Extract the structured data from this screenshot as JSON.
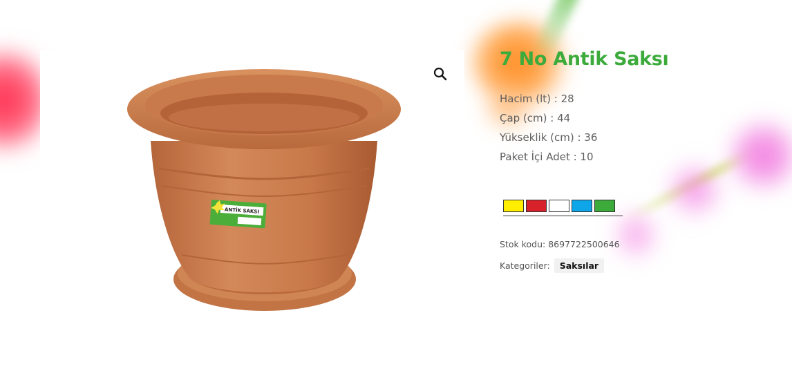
{
  "product": {
    "title": "7 No Antik Saksı",
    "specs": [
      "Hacim (lt) : 28",
      "Çap (cm) : 44",
      "Yükseklik (cm) : 36",
      "Paket İçi Adet : 10"
    ],
    "label_text": "ANTİK SAKSI",
    "colors": [
      {
        "name": "yellow",
        "hex": "#ffee00"
      },
      {
        "name": "red",
        "hex": "#d7222b"
      },
      {
        "name": "white",
        "hex": "#ffffff"
      },
      {
        "name": "blue",
        "hex": "#0ea5e9"
      },
      {
        "name": "green",
        "hex": "#3cab3c"
      }
    ],
    "sku_label": "Stok kodu:",
    "sku_value": "8697722500646",
    "category_label": "Kategoriler:",
    "category_value": "Saksılar"
  },
  "gallery": {
    "zoom_icon": "search-icon"
  },
  "theme": {
    "title_color": "#3cab3c",
    "pot_color": "#c97a4c"
  }
}
